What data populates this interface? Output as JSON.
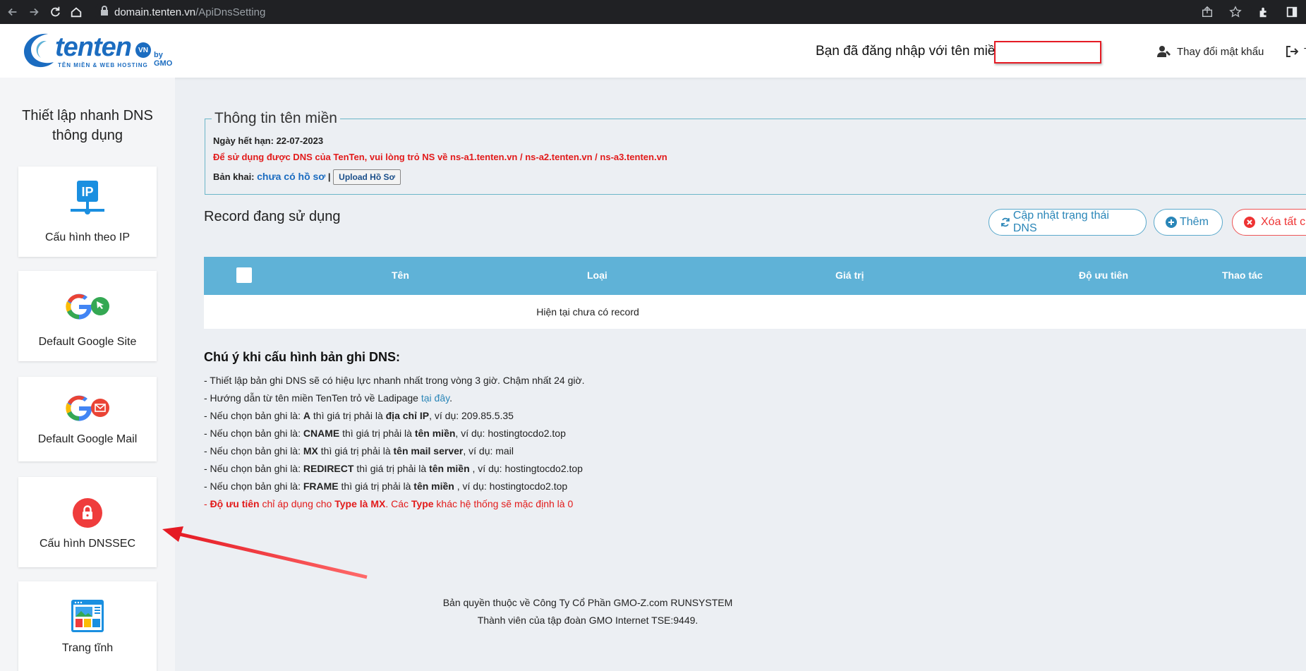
{
  "browser": {
    "url_host": "domain.tenten.vn",
    "url_path": "/ApiDnsSetting"
  },
  "header": {
    "logo_text": "tenten",
    "logo_sub": "TÊN MIỀN & WEB HOSTING",
    "logo_vn": "VN",
    "logo_gmo": "by GMO",
    "login_label": "Bạn đã đăng nhập với tên miền",
    "change_password": "Thay đổi mật khẩu",
    "logout": "T"
  },
  "sidebar": {
    "title_line1": "Thiết lập nhanh DNS",
    "title_line2": "thông dụng",
    "cards": [
      {
        "label": "Cấu hình theo IP",
        "icon": "ip-network-icon"
      },
      {
        "label": "Default Google Site",
        "icon": "google-site-icon"
      },
      {
        "label": "Default Google Mail",
        "icon": "google-mail-icon"
      },
      {
        "label": "Cấu hình DNSSEC",
        "icon": "lock-icon"
      },
      {
        "label": "Trang tĩnh",
        "icon": "static-page-icon"
      }
    ]
  },
  "domain_info": {
    "legend": "Thông tin tên miền",
    "expiry": "Ngày hết hạn: 22-07-2023",
    "ns_notice": "Để sử dụng được DNS của TenTen, vui lòng trỏ NS về ns-a1.tenten.vn / ns-a2.tenten.vn / ns-a3.tenten.vn",
    "declaration_label": "Bản khai:",
    "declaration_status": "chưa có hồ sơ",
    "separator": "|",
    "upload_button": "Upload Hồ Sơ"
  },
  "records": {
    "title": "Record đang sử dụng",
    "update_button": "Cập nhật trạng thái DNS",
    "add_button": "Thêm",
    "delete_all_button": "Xóa tất c",
    "columns": [
      "Tên",
      "Loại",
      "Giá trị",
      "Độ ưu tiên",
      "Thao tác"
    ],
    "empty_text": "Hiện tại chưa có record"
  },
  "notes": {
    "title": "Chú ý khi cấu hình bản ghi DNS:",
    "line1": "- Thiết lập bản ghi DNS sẽ có hiệu lực nhanh nhất trong vòng 3 giờ. Chậm nhất 24 giờ.",
    "line2_prefix": "- Hướng dẫn từ tên miền TenTen trỏ về Ladipage ",
    "line2_link": "tại đây",
    "line2_suffix": ".",
    "a_prefix": "- Nếu chọn bản ghi là: ",
    "a_type": "A",
    "a_mid": " thì giá trị phải là ",
    "a_val": "địa chỉ IP",
    "a_ex": ", ví dụ: 209.85.5.35",
    "cname_prefix": "- Nếu chọn bản ghi là: ",
    "cname_type": "CNAME",
    "cname_mid": " thì giá trị phải là ",
    "cname_val": "tên miền",
    "cname_ex": ", ví dụ: hostingtocdo2.top",
    "mx_prefix": "- Nếu chọn bản ghi là: ",
    "mx_type": "MX",
    "mx_mid": " thì giá trị phải là ",
    "mx_val": "tên mail server",
    "mx_ex": ", ví dụ: mail",
    "redirect_prefix": "- Nếu chọn bản ghi là: ",
    "redirect_type": "REDIRECT",
    "redirect_mid": " thì giá trị phải là ",
    "redirect_val": "tên miền",
    "redirect_ex": " , ví dụ: hostingtocdo2.top",
    "frame_prefix": "- Nếu chọn bản ghi là: ",
    "frame_type": "FRAME",
    "frame_mid": " thì giá trị phải là ",
    "frame_val": "tên miền",
    "frame_ex": " , ví dụ: hostingtocdo2.top",
    "prio_prefix": "- ",
    "prio_b1": "Độ ưu tiên",
    "prio_t1": " chỉ áp dụng cho ",
    "prio_b2": "Type là MX",
    "prio_t2": ". Các ",
    "prio_b3": "Type",
    "prio_t3": " khác hệ thống sẽ mặc định là 0"
  },
  "footer": {
    "line1": "Bản quyền thuộc về Công Ty Cổ Phần GMO-Z.com RUNSYSTEM",
    "line2": "Thành viên của tập đoàn GMO Internet TSE:9449."
  },
  "colors": {
    "brand_blue": "#1b6cc0",
    "table_header": "#5fb2d7",
    "alert_red": "#e21b1b",
    "annotation_red": "#e51b24"
  }
}
